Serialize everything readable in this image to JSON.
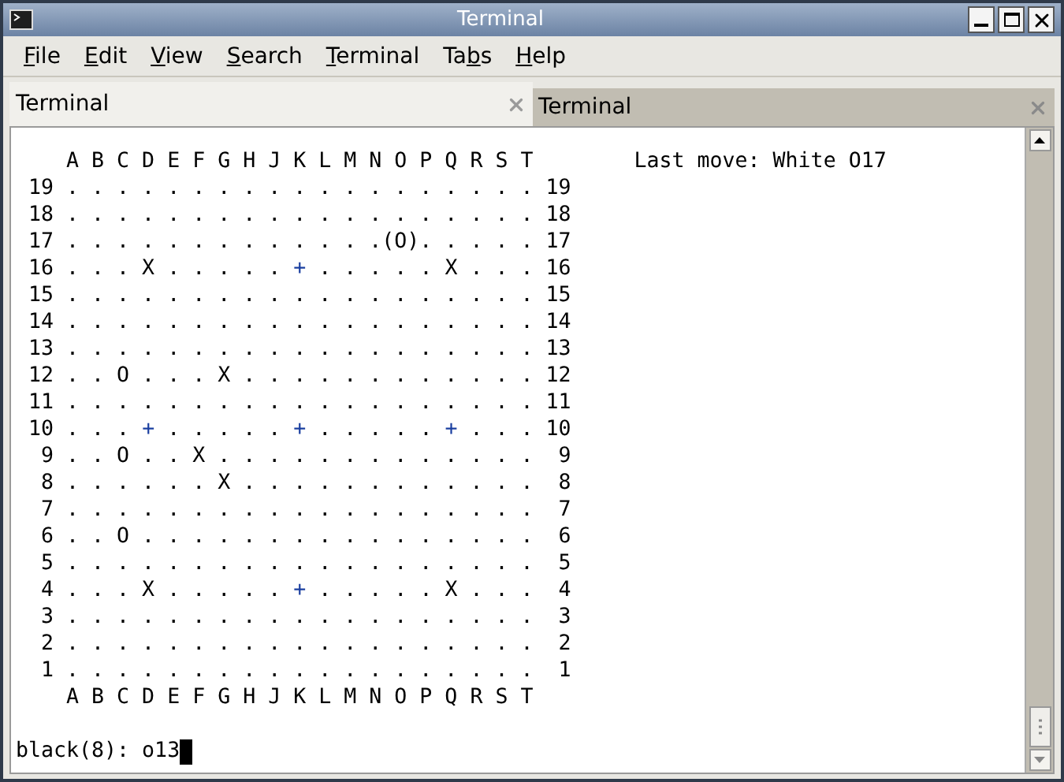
{
  "window": {
    "title": "Terminal"
  },
  "menu": [
    {
      "mnemonic": "F",
      "rest": "ile"
    },
    {
      "mnemonic": "E",
      "rest": "dit"
    },
    {
      "mnemonic": "V",
      "rest": "iew"
    },
    {
      "mnemonic": "S",
      "rest": "earch"
    },
    {
      "mnemonic": "T",
      "rest": "erminal"
    },
    {
      "start": "Ta",
      "mnemonic": "b",
      "rest": "s"
    },
    {
      "mnemonic": "H",
      "rest": "elp"
    }
  ],
  "tabs": [
    {
      "label": "Terminal",
      "selected": true
    },
    {
      "label": "Terminal",
      "selected": false
    }
  ],
  "terminal": {
    "status": "Last move: White O17",
    "lines": [
      [
        {
          "kind": "text",
          "text": "    A B C D E F G H J K L M N O P Q R S T"
        }
      ],
      [
        {
          "kind": "text",
          "text": " 19 . . . . . . . . . . . . . . . . . . . 19"
        }
      ],
      [
        {
          "kind": "text",
          "text": " 18 . . . . . . . . . . . . . . . . . . . 18"
        }
      ],
      [
        {
          "kind": "text",
          "text": " 17 . . . . . . . . . . . . .(O). . . . . 17"
        }
      ],
      [
        {
          "kind": "text",
          "text": " 16 . . . X . . . . . "
        },
        {
          "kind": "star_point",
          "text": "+"
        },
        {
          "kind": "text",
          "text": " . . . . . X . . . 16"
        }
      ],
      [
        {
          "kind": "text",
          "text": " 15 . . . . . . . . . . . . . . . . . . . 15"
        }
      ],
      [
        {
          "kind": "text",
          "text": " 14 . . . . . . . . . . . . . . . . . . . 14"
        }
      ],
      [
        {
          "kind": "text",
          "text": " 13 . . . . . . . . . . . . . . . . . . . 13"
        }
      ],
      [
        {
          "kind": "text",
          "text": " 12 . . O . . . X . . . . . . . . . . . . 12"
        }
      ],
      [
        {
          "kind": "text",
          "text": " 11 . . . . . . . . . . . . . . . . . . . 11"
        }
      ],
      [
        {
          "kind": "text",
          "text": " 10 . . . "
        },
        {
          "kind": "star_point",
          "text": "+"
        },
        {
          "kind": "text",
          "text": " . . . . . "
        },
        {
          "kind": "star_point",
          "text": "+"
        },
        {
          "kind": "text",
          "text": " . . . . . "
        },
        {
          "kind": "star_point",
          "text": "+"
        },
        {
          "kind": "text",
          "text": " . . . 10"
        }
      ],
      [
        {
          "kind": "text",
          "text": "  9 . . O . . X . . . . . . . . . . . . .  9"
        }
      ],
      [
        {
          "kind": "text",
          "text": "  8 . . . . . . X . . . . . . . . . . . .  8"
        }
      ],
      [
        {
          "kind": "text",
          "text": "  7 . . . . . . . . . . . . . . . . . . .  7"
        }
      ],
      [
        {
          "kind": "text",
          "text": "  6 . . O . . . . . . . . . . . . . . . .  6"
        }
      ],
      [
        {
          "kind": "text",
          "text": "  5 . . . . . . . . . . . . . . . . . . .  5"
        }
      ],
      [
        {
          "kind": "text",
          "text": "  4 . . . X . . . . . "
        },
        {
          "kind": "star_point",
          "text": "+"
        },
        {
          "kind": "text",
          "text": " . . . . . X . . .  4"
        }
      ],
      [
        {
          "kind": "text",
          "text": "  3 . . . . . . . . . . . . . . . . . . .  3"
        }
      ],
      [
        {
          "kind": "text",
          "text": "  2 . . . . . . . . . . . . . . . . . . .  2"
        }
      ],
      [
        {
          "kind": "text",
          "text": "  1 . . . . . . . . . . . . . . . . . . .  1"
        }
      ],
      [
        {
          "kind": "text",
          "text": "    A B C D E F G H J K L M N O P Q R S T"
        }
      ]
    ],
    "prompt": "black(8): o13"
  }
}
